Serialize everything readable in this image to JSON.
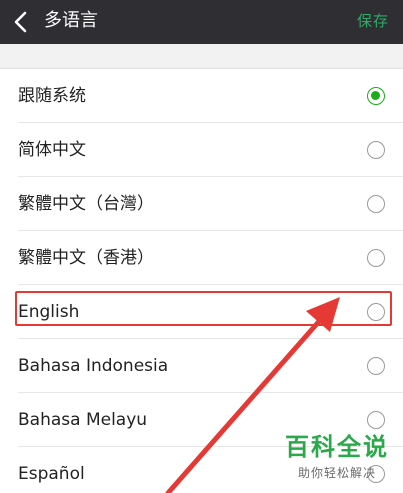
{
  "header": {
    "title": "多语言",
    "save_label": "保存"
  },
  "colors": {
    "header_bg": "#2e2e33",
    "accent_green": "#1aad19",
    "highlight_red": "#e53935"
  },
  "languages": [
    {
      "label": "跟随系统",
      "selected": true
    },
    {
      "label": "简体中文",
      "selected": false
    },
    {
      "label": "繁體中文（台灣）",
      "selected": false
    },
    {
      "label": "繁體中文（香港）",
      "selected": false
    },
    {
      "label": "English",
      "selected": false
    },
    {
      "label": "Bahasa Indonesia",
      "selected": false
    },
    {
      "label": "Bahasa Melayu",
      "selected": false
    },
    {
      "label": "Español",
      "selected": false
    }
  ],
  "watermark": {
    "title": "百科全说",
    "subtitle": "助你轻松解决"
  }
}
